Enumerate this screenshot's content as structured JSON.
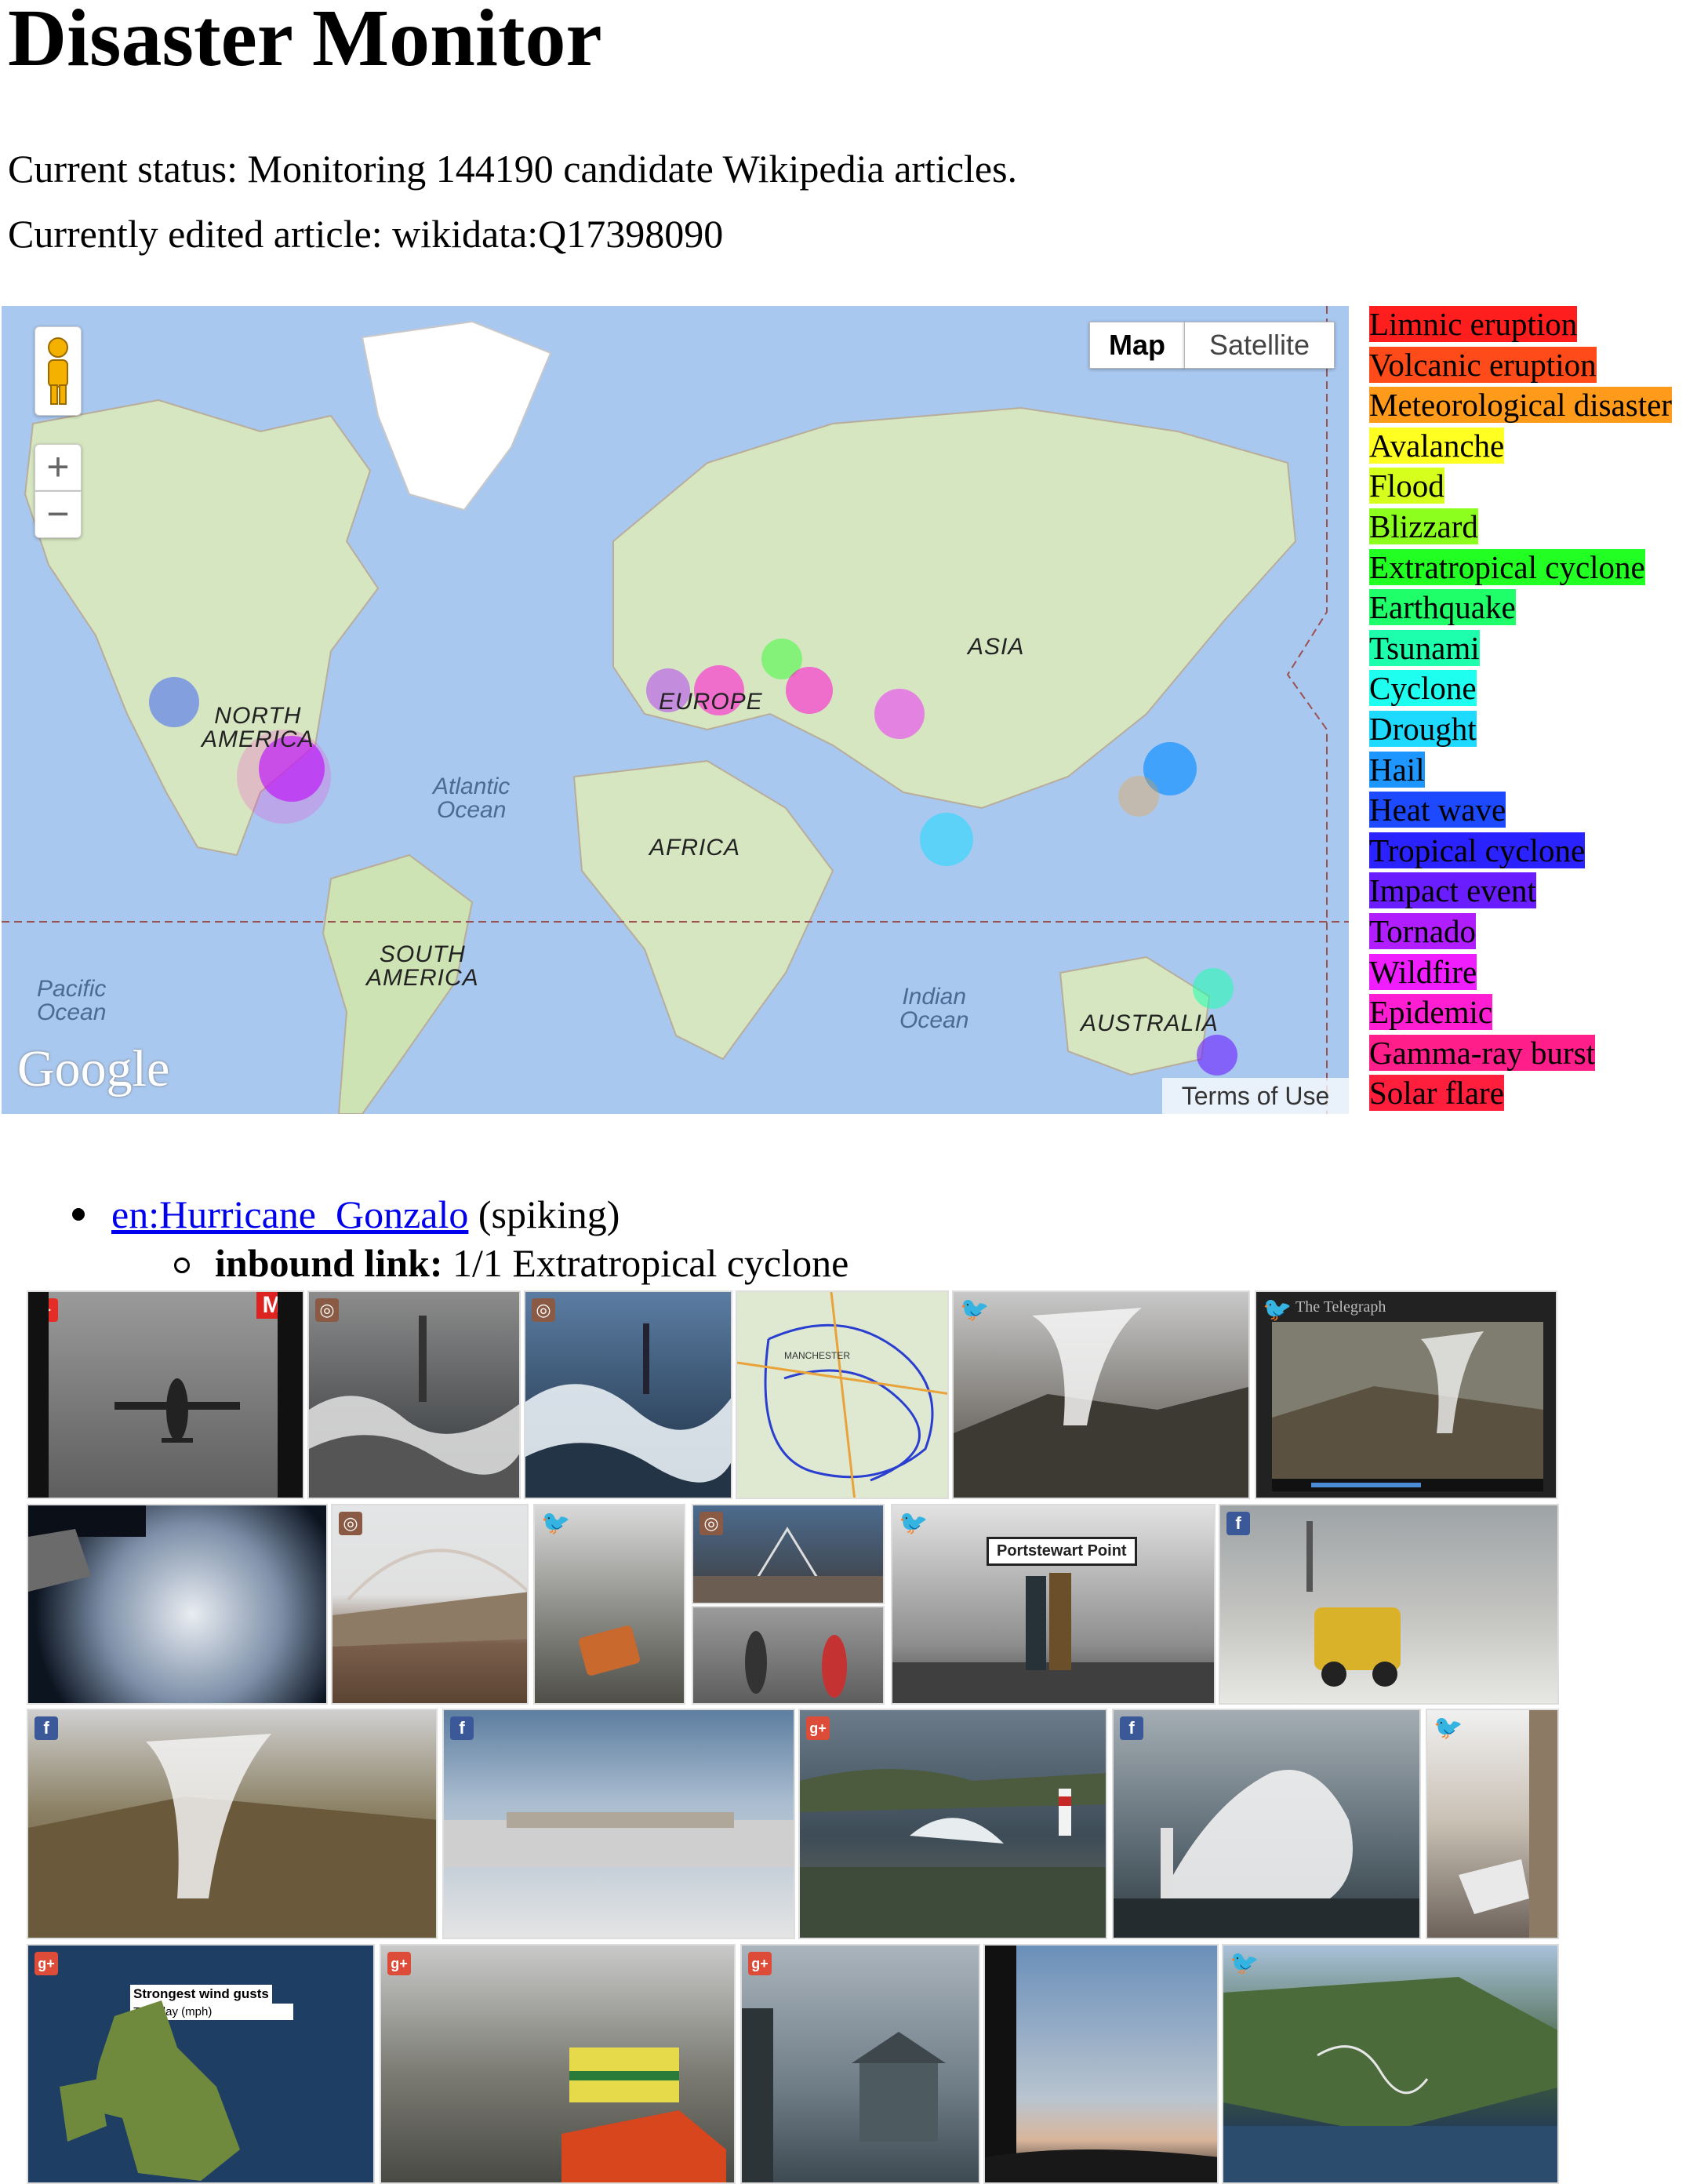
{
  "page": {
    "title": "Disaster Monitor",
    "status_line": "Current status: Monitoring 144190 candidate Wikipedia articles.",
    "edited_line": "Currently edited article: wikidata:Q17398090"
  },
  "map": {
    "type_map": "Map",
    "type_satellite": "Satellite",
    "zoom_in": "+",
    "zoom_out": "−",
    "logo": "Google",
    "terms": "Terms of Use",
    "labels": {
      "north_america": "NORTH\nAMERICA",
      "south_america": "SOUTH\nAMERICA",
      "europe": "EUROPE",
      "asia": "ASIA",
      "africa": "AFRICA",
      "australia": "AUSTRALIA",
      "atlantic": "Atlantic\nOcean",
      "pacific": "Pacific\nOcean",
      "indian": "Indian\nOcean"
    },
    "colors": {
      "ocean": "#a9c8ef",
      "land": "#d6e6c1",
      "green": "#b9d79f"
    }
  },
  "legend": [
    {
      "label": "Limnic eruption",
      "color": "#ff1e1e"
    },
    {
      "label": "Volcanic eruption",
      "color": "#ff4a1a"
    },
    {
      "label": "Meteorological disaster",
      "color": "#ff9a1a"
    },
    {
      "label": "Avalanche",
      "color": "#ffff22"
    },
    {
      "label": "Flood",
      "color": "#d6ff1e"
    },
    {
      "label": "Blizzard",
      "color": "#8dff1e"
    },
    {
      "label": "Extratropical cyclone",
      "color": "#22ff22"
    },
    {
      "label": "Earthquake",
      "color": "#1eff6a"
    },
    {
      "label": "Tsunami",
      "color": "#1effae"
    },
    {
      "label": "Cyclone",
      "color": "#1efff0"
    },
    {
      "label": "Drought",
      "color": "#1edaff"
    },
    {
      "label": "Hail",
      "color": "#1e96ff"
    },
    {
      "label": "Heat wave",
      "color": "#1e4aff"
    },
    {
      "label": "Tropical cyclone",
      "color": "#2a22ff"
    },
    {
      "label": "Impact event",
      "color": "#6a1eff"
    },
    {
      "label": "Tornado",
      "color": "#b01eff"
    },
    {
      "label": "Wildfire",
      "color": "#f01eff"
    },
    {
      "label": "Epidemic",
      "color": "#ff1ed2"
    },
    {
      "label": "Gamma-ray burst",
      "color": "#ff1e8a"
    },
    {
      "label": "Solar flare",
      "color": "#ff1e3c"
    }
  ],
  "article": {
    "link": "en:Hurricane_Gonzalo",
    "state": " (spiking)",
    "inbound_label": "inbound link:",
    "inbound_value": " 1/1 Extratropical cyclone"
  },
  "gallery": {
    "tile1_badge": "Mi",
    "tile6_caption": "The Telegraph",
    "sign_text": "Portstewart Point",
    "wind_title": "Strongest wind gusts",
    "wind_sub": "Tuesday (mph)"
  }
}
